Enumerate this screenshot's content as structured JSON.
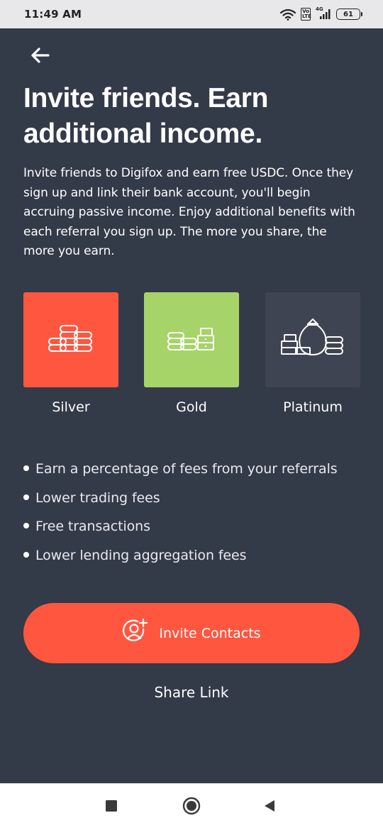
{
  "status_bar": {
    "time": "11:49 AM",
    "lte_label": "Vo LTE",
    "network_label": "4G",
    "battery_level": "61",
    "icons": [
      "wifi-icon",
      "lte-icon",
      "signal-icon",
      "battery-icon"
    ]
  },
  "header": {
    "back_icon": "arrow-left-icon",
    "title": "Invite friends. Earn additional income.",
    "description": "Invite friends to Digifox and earn free USDC. Once they sign up and link their bank account, you'll begin accruing passive income. Enjoy additional benefits with each referral you sign up. The more you share, the more you earn."
  },
  "tiers": [
    {
      "label": "Silver",
      "icon": "coins-stack-icon",
      "color": "#ff5640"
    },
    {
      "label": "Gold",
      "icon": "coins-bills-icon",
      "color": "#a6d468"
    },
    {
      "label": "Platinum",
      "icon": "money-bag-icon",
      "color": "#3f4452"
    }
  ],
  "benefits": [
    "Earn a percentage of fees from your referrals",
    "Lower trading fees",
    "Free transactions",
    "Lower lending aggregation fees"
  ],
  "actions": {
    "invite_label": "Invite Contacts",
    "invite_icon": "add-user-icon",
    "share_label": "Share Link"
  },
  "nav_bar": {
    "icons": [
      "recent-apps-icon",
      "home-icon",
      "back-triangle-icon"
    ]
  },
  "colors": {
    "background": "#333a48",
    "accent": "#ff5640",
    "gold": "#a6d468",
    "platinum": "#3f4452"
  }
}
